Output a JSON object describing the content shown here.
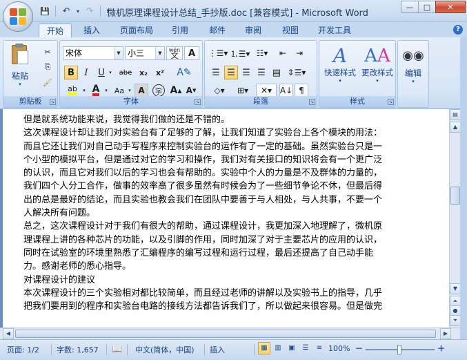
{
  "window": {
    "title": "微机原理课程设计总结_手抄版.doc [兼容模式] - Microsoft Word",
    "controls": {
      "minimize": "—",
      "maximize": "□",
      "close": "✕"
    }
  },
  "quick_access": {
    "save": "💾",
    "undo": "↶",
    "redo": "↷",
    "customize": "▾"
  },
  "tabs": [
    "开始",
    "插入",
    "页面布局",
    "引用",
    "邮件",
    "审阅",
    "视图",
    "开发工具"
  ],
  "help": "?",
  "ribbon": {
    "clipboard": {
      "label": "剪贴板",
      "paste": "粘贴"
    },
    "font": {
      "label": "字体",
      "name": "宋体",
      "size": "小三",
      "phonetic": "wén",
      "buttons": [
        "B",
        "I",
        "U",
        "abe",
        "x₂",
        "x²",
        "Aa",
        "A",
        "字",
        "A",
        "A"
      ]
    },
    "paragraph": {
      "label": "段落"
    },
    "styles": {
      "label": "样式",
      "quick_styles": "快速样式",
      "change_styles": "更改样式"
    },
    "editing": {
      "label": "编辑"
    }
  },
  "document": {
    "lines": [
      "但是就系统功能来说，我觉得我们做的还是不错的。",
      "    这次课程设计却让我们对实验台有了足够的了解，让我们知道了实验台上各个模块的用法：",
      "而且它还让我们对自己动手写程序来控制实验台的运作有了一定的基础。虽然实验台只是一",
      "个小型的模拟平台，但是通过对它的学习和操作，我们对有关接口的知识将会有一个更广泛",
      "的认识，而且它对我们以后的学习也会有帮助的。实验中个人的力量是不及群体的力量的，",
      "我们四个人分工合作，做事的效率高了很多虽然有时候会为了一些细节争论不休，但最后得",
      "出的总是最好的结论，而且实验也教会我们在团队中要善于与人相处，与人共事，不要一个",
      "人解决所有问题。",
      "    总之，这次课程设计对于我们有很大的帮助，通过课程设计，我更加深入地理解了，微机原",
      "理课程上讲的各种芯片的功能，以及引脚的作用，同时加深了对于主要芯片的应用的认识，",
      "同时在试验室的环境里熟悉了汇编程序的编写过程和运行过程，最后还提高了自己动手能",
      "力。感谢老师的悉心指导。",
      "对课程设计的建议",
      "    本次课程设计的三个实验相对都比较简单，而且经过老师的讲解以及实验书上的指导，几乎",
      "把我们要用到的程序和实验台电路的接线方法都告诉我们了，所以做起来很容易。但是做完"
    ]
  },
  "status": {
    "page": "页面: 1/2",
    "words": "字数: 1,657",
    "language": "中文(简体，中国)",
    "mode": "插入",
    "zoom": "100%",
    "zoom_minus": "－",
    "zoom_plus": "＋"
  }
}
